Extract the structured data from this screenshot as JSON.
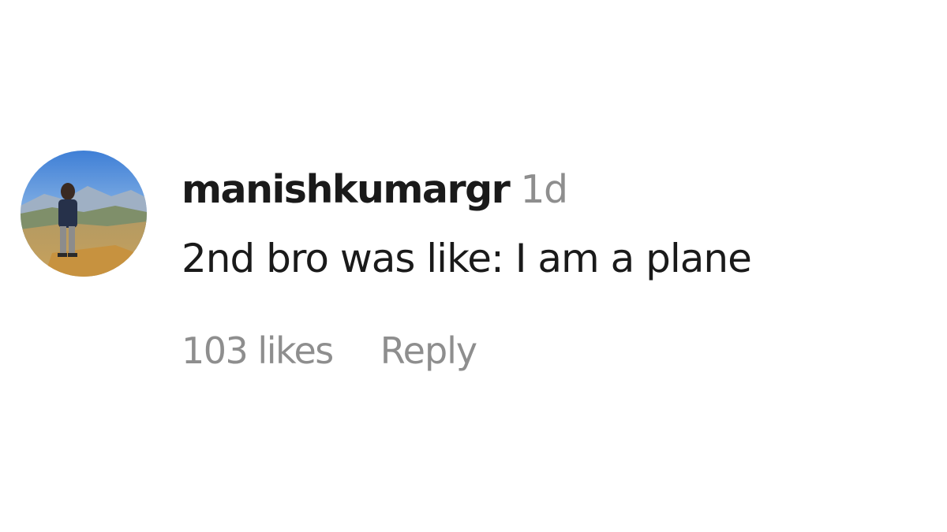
{
  "comment": {
    "avatar_icon": "user-avatar-photo",
    "username": "manishkumargr",
    "timestamp": "1d",
    "text": "2nd bro was like: I am a plane",
    "likes": "103 likes",
    "reply_label": "Reply"
  },
  "colors": {
    "text_primary": "#1a1a1a",
    "text_secondary": "#8e8e8e",
    "background": "#ffffff"
  }
}
